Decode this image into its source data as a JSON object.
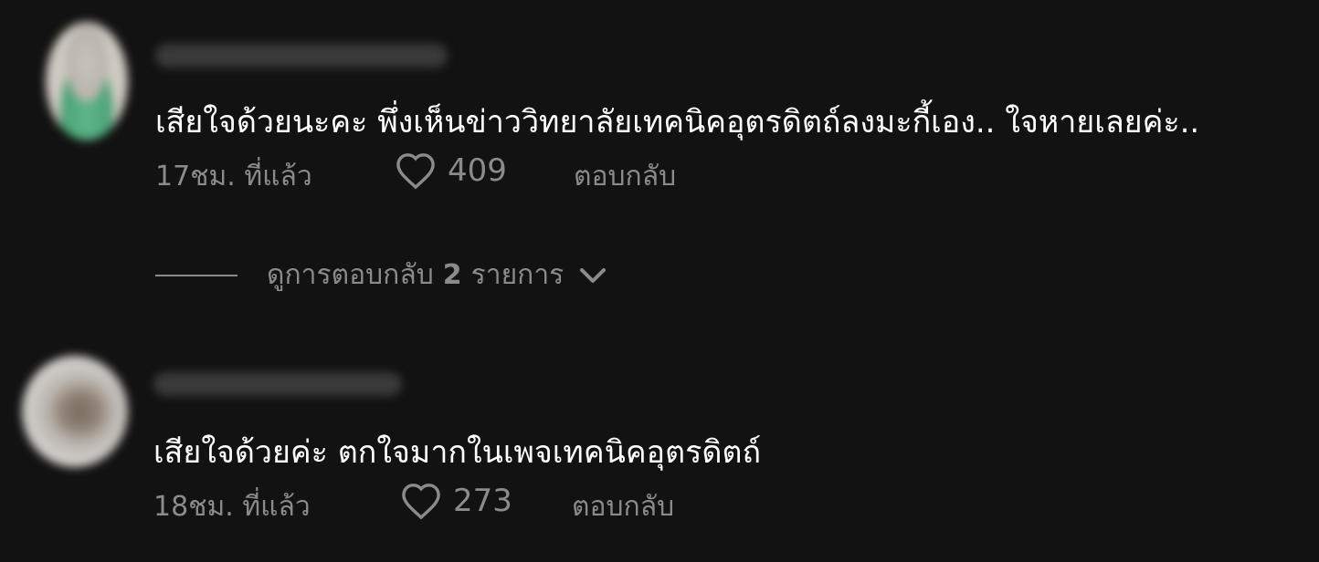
{
  "comments": [
    {
      "text": "เสียใจด้วยนะคะ พึ่งเห็นข่าววิทยาลัยเทคนิคอุตรดิตถ์ลงมะกี้เอง.. ใจหายเลยค่ะ..",
      "time": "17ชม. ที่แล้ว",
      "likes": "409",
      "reply_label": "ตอบกลับ",
      "view_replies": {
        "prefix": "ดูการตอบกลับ",
        "count": "2",
        "suffix": "รายการ"
      }
    },
    {
      "text": "เสียใจด้วยค่ะ ตกใจมากในเพจเทคนิคอุตรดิตถ์",
      "time": "18ชม. ที่แล้ว",
      "likes": "273",
      "reply_label": "ตอบกลับ"
    }
  ],
  "icons": {
    "like": "heart-outline-icon",
    "expand": "chevron-down-icon"
  },
  "colors": {
    "background": "#121212",
    "text": "#ffffff",
    "muted": "#8b8b8b"
  }
}
